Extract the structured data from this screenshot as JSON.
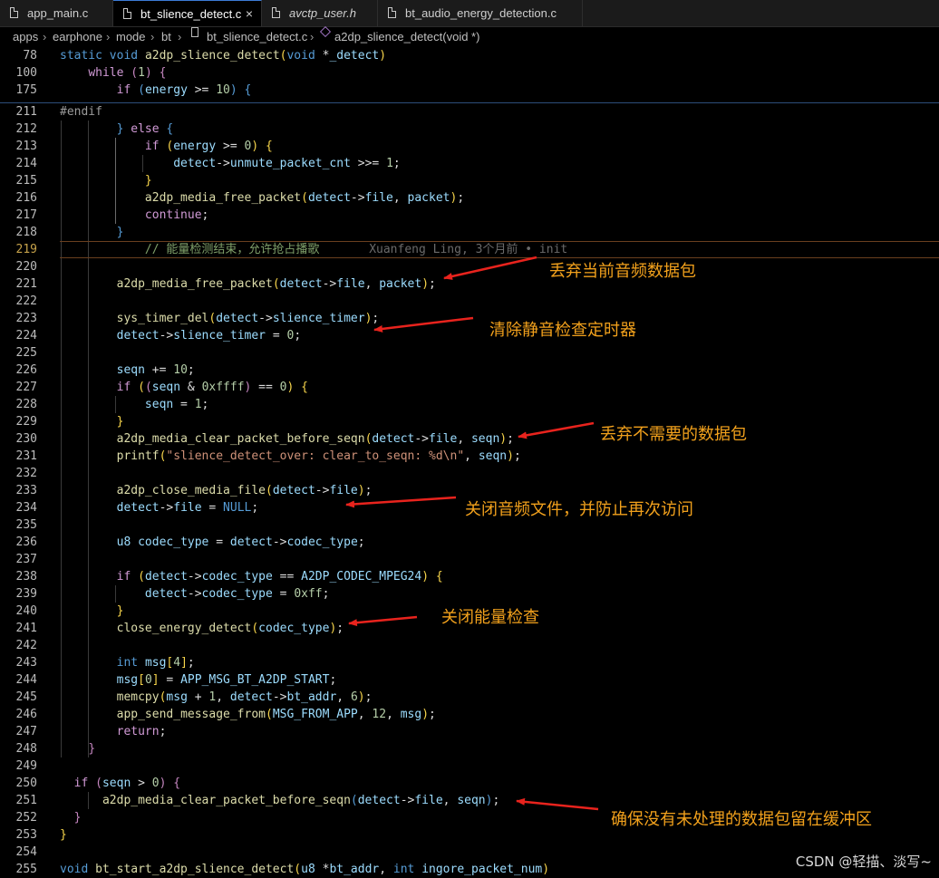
{
  "tabs": [
    {
      "label": "app_main.c",
      "active": false,
      "italic": false
    },
    {
      "label": "bt_slience_detect.c",
      "active": true,
      "italic": false,
      "close": "×"
    },
    {
      "label": "avctp_user.h",
      "active": false,
      "italic": true
    },
    {
      "label": "bt_audio_energy_detection.c",
      "active": false,
      "italic": false
    }
  ],
  "breadcrumb": [
    "apps",
    "earphone",
    "mode",
    "bt",
    "bt_slience_detect.c",
    "a2dp_slience_detect(void *)"
  ],
  "sticky_lines": [
    {
      "num": "78",
      "text": "static void a2dp_slience_detect(void *_detect)"
    },
    {
      "num": "100",
      "text": "    while (1) {"
    },
    {
      "num": "175",
      "text": "        if (energy >= 10) {"
    }
  ],
  "code_lines": [
    {
      "num": "211",
      "text": "#endif"
    },
    {
      "num": "212",
      "text": "            } else {"
    },
    {
      "num": "213",
      "text": "                if (energy >= 0) {"
    },
    {
      "num": "214",
      "text": "                    detect->unmute_packet_cnt >>= 1;"
    },
    {
      "num": "215",
      "text": "                }"
    },
    {
      "num": "216",
      "text": "                a2dp_media_free_packet(detect->file, packet);"
    },
    {
      "num": "217",
      "text": "                continue;"
    },
    {
      "num": "218",
      "text": "            }"
    },
    {
      "num": "219",
      "text": "            // 能量检测结束，允许抢占播歌"
    },
    {
      "num": "220",
      "text": ""
    },
    {
      "num": "221",
      "text": "            a2dp_media_free_packet(detect->file, packet);"
    },
    {
      "num": "222",
      "text": ""
    },
    {
      "num": "223",
      "text": "            sys_timer_del(detect->slience_timer);"
    },
    {
      "num": "224",
      "text": "            detect->slience_timer = 0;"
    },
    {
      "num": "225",
      "text": ""
    },
    {
      "num": "226",
      "text": "            seqn += 10;"
    },
    {
      "num": "227",
      "text": "            if ((seqn & 0xffff) == 0) {"
    },
    {
      "num": "228",
      "text": "                seqn = 1;"
    },
    {
      "num": "229",
      "text": "            }"
    },
    {
      "num": "230",
      "text": "            a2dp_media_clear_packet_before_seqn(detect->file, seqn);"
    },
    {
      "num": "231",
      "text": "            printf(\"slience_detect_over: clear_to_seqn: %d\\n\", seqn);"
    },
    {
      "num": "232",
      "text": ""
    },
    {
      "num": "233",
      "text": "            a2dp_close_media_file(detect->file);"
    },
    {
      "num": "234",
      "text": "            detect->file = NULL;"
    },
    {
      "num": "235",
      "text": ""
    },
    {
      "num": "236",
      "text": "            u8 codec_type = detect->codec_type;"
    },
    {
      "num": "237",
      "text": ""
    },
    {
      "num": "238",
      "text": "            if (detect->codec_type == A2DP_CODEC_MPEG24) {"
    },
    {
      "num": "239",
      "text": "                detect->codec_type = 0xff;"
    },
    {
      "num": "240",
      "text": "            }"
    },
    {
      "num": "241",
      "text": "            close_energy_detect(codec_type);"
    },
    {
      "num": "242",
      "text": ""
    },
    {
      "num": "243",
      "text": "            int msg[4];"
    },
    {
      "num": "244",
      "text": "            msg[0] = APP_MSG_BT_A2DP_START;"
    },
    {
      "num": "245",
      "text": "            memcpy(msg + 1, detect->bt_addr, 6);"
    },
    {
      "num": "246",
      "text": "            app_send_message_from(MSG_FROM_APP, 12, msg);"
    },
    {
      "num": "247",
      "text": "            return;"
    },
    {
      "num": "248",
      "text": "        }"
    },
    {
      "num": "249",
      "text": ""
    },
    {
      "num": "250",
      "text": "    if (seqn > 0) {"
    },
    {
      "num": "251",
      "text": "        a2dp_media_clear_packet_before_seqn(detect->file, seqn);"
    },
    {
      "num": "252",
      "text": "    }"
    },
    {
      "num": "253",
      "text": "}"
    },
    {
      "num": "254",
      "text": ""
    },
    {
      "num": "255",
      "text": "void bt_start_a2dp_slience_detect(u8 *bt_addr, int ingore_packet_num)"
    }
  ],
  "current_line": "219",
  "blame": "Xuanfeng Ling, 3个月前 • init",
  "annotations": [
    "丢弃当前音频数据包",
    "清除静音检查定时器",
    "丢弃不需要的数据包",
    "关闭音频文件，并防止再次访问",
    "关闭能量检查",
    "确保没有未处理的数据包留在缓冲区"
  ],
  "watermark": "CSDN @轻描、淡写~",
  "colors": {
    "annotation": "#f2a11c",
    "arrow": "#e8231d",
    "current_line_number": "#c6a24a"
  }
}
